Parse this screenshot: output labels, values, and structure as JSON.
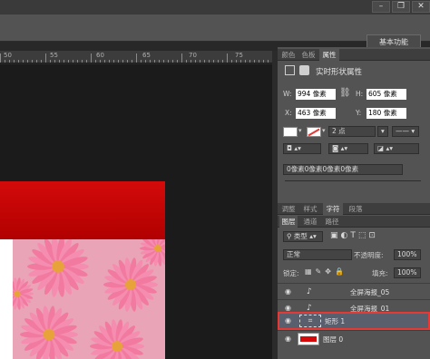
{
  "window": {
    "minimize_icon": "minimize-icon",
    "restore_icon": "restore-icon",
    "close_icon": "close-icon",
    "workspace_label": "基本功能"
  },
  "ruler": {
    "labels": [
      "50",
      "55",
      "60",
      "65",
      "70",
      "75"
    ]
  },
  "properties_panel": {
    "tabs": [
      "颜色",
      "色板",
      "属性"
    ],
    "active_tab": "属性",
    "title": "实时形状属性",
    "w_label": "W:",
    "w_value": "994 像素",
    "h_label": "H:",
    "h_value": "605 像素",
    "x_label": "X:",
    "x_value": "463 像素",
    "y_label": "Y:",
    "y_value": "180 像素",
    "stroke_width": "2 点",
    "corner_radius": "0像素0像素0像素0像素"
  },
  "layers_panel": {
    "top_tabs": [
      "调整",
      "样式",
      "字符",
      "段落"
    ],
    "sub_tabs": [
      "图层",
      "通道",
      "路径"
    ],
    "filter_label": "类型",
    "blend_mode": "正常",
    "opacity_label": "不透明度:",
    "opacity_value": "100%",
    "lock_label": "锁定:",
    "fill_label": "填充:",
    "fill_value": "100%",
    "layers": [
      {
        "name": "全屏海报_05",
        "type": "text"
      },
      {
        "name": "全屏海报_01",
        "type": "text"
      },
      {
        "name": "矩形 1",
        "type": "shape",
        "selected": true
      },
      {
        "name": "图层 0",
        "type": "image"
      }
    ]
  },
  "colors": {
    "accent_red": "#d40a0a",
    "selection_outline": "#e53935",
    "panel_bg": "#535353"
  }
}
